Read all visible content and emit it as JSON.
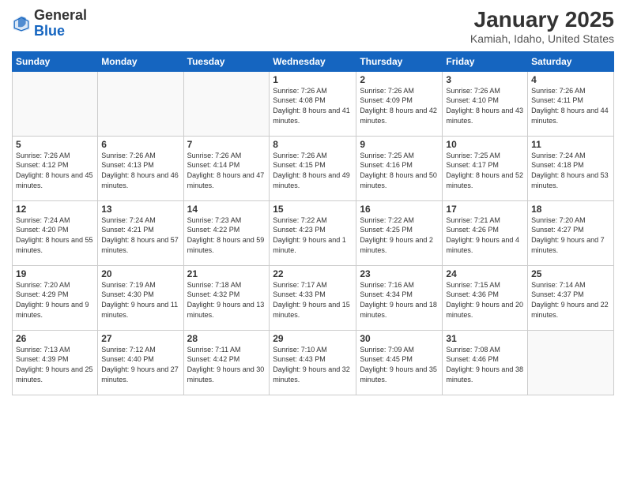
{
  "logo": {
    "general": "General",
    "blue": "Blue"
  },
  "title": "January 2025",
  "subtitle": "Kamiah, Idaho, United States",
  "days_of_week": [
    "Sunday",
    "Monday",
    "Tuesday",
    "Wednesday",
    "Thursday",
    "Friday",
    "Saturday"
  ],
  "weeks": [
    [
      {
        "day": "",
        "info": ""
      },
      {
        "day": "",
        "info": ""
      },
      {
        "day": "",
        "info": ""
      },
      {
        "day": "1",
        "info": "Sunrise: 7:26 AM\nSunset: 4:08 PM\nDaylight: 8 hours and 41 minutes."
      },
      {
        "day": "2",
        "info": "Sunrise: 7:26 AM\nSunset: 4:09 PM\nDaylight: 8 hours and 42 minutes."
      },
      {
        "day": "3",
        "info": "Sunrise: 7:26 AM\nSunset: 4:10 PM\nDaylight: 8 hours and 43 minutes."
      },
      {
        "day": "4",
        "info": "Sunrise: 7:26 AM\nSunset: 4:11 PM\nDaylight: 8 hours and 44 minutes."
      }
    ],
    [
      {
        "day": "5",
        "info": "Sunrise: 7:26 AM\nSunset: 4:12 PM\nDaylight: 8 hours and 45 minutes."
      },
      {
        "day": "6",
        "info": "Sunrise: 7:26 AM\nSunset: 4:13 PM\nDaylight: 8 hours and 46 minutes."
      },
      {
        "day": "7",
        "info": "Sunrise: 7:26 AM\nSunset: 4:14 PM\nDaylight: 8 hours and 47 minutes."
      },
      {
        "day": "8",
        "info": "Sunrise: 7:26 AM\nSunset: 4:15 PM\nDaylight: 8 hours and 49 minutes."
      },
      {
        "day": "9",
        "info": "Sunrise: 7:25 AM\nSunset: 4:16 PM\nDaylight: 8 hours and 50 minutes."
      },
      {
        "day": "10",
        "info": "Sunrise: 7:25 AM\nSunset: 4:17 PM\nDaylight: 8 hours and 52 minutes."
      },
      {
        "day": "11",
        "info": "Sunrise: 7:24 AM\nSunset: 4:18 PM\nDaylight: 8 hours and 53 minutes."
      }
    ],
    [
      {
        "day": "12",
        "info": "Sunrise: 7:24 AM\nSunset: 4:20 PM\nDaylight: 8 hours and 55 minutes."
      },
      {
        "day": "13",
        "info": "Sunrise: 7:24 AM\nSunset: 4:21 PM\nDaylight: 8 hours and 57 minutes."
      },
      {
        "day": "14",
        "info": "Sunrise: 7:23 AM\nSunset: 4:22 PM\nDaylight: 8 hours and 59 minutes."
      },
      {
        "day": "15",
        "info": "Sunrise: 7:22 AM\nSunset: 4:23 PM\nDaylight: 9 hours and 1 minute."
      },
      {
        "day": "16",
        "info": "Sunrise: 7:22 AM\nSunset: 4:25 PM\nDaylight: 9 hours and 2 minutes."
      },
      {
        "day": "17",
        "info": "Sunrise: 7:21 AM\nSunset: 4:26 PM\nDaylight: 9 hours and 4 minutes."
      },
      {
        "day": "18",
        "info": "Sunrise: 7:20 AM\nSunset: 4:27 PM\nDaylight: 9 hours and 7 minutes."
      }
    ],
    [
      {
        "day": "19",
        "info": "Sunrise: 7:20 AM\nSunset: 4:29 PM\nDaylight: 9 hours and 9 minutes."
      },
      {
        "day": "20",
        "info": "Sunrise: 7:19 AM\nSunset: 4:30 PM\nDaylight: 9 hours and 11 minutes."
      },
      {
        "day": "21",
        "info": "Sunrise: 7:18 AM\nSunset: 4:32 PM\nDaylight: 9 hours and 13 minutes."
      },
      {
        "day": "22",
        "info": "Sunrise: 7:17 AM\nSunset: 4:33 PM\nDaylight: 9 hours and 15 minutes."
      },
      {
        "day": "23",
        "info": "Sunrise: 7:16 AM\nSunset: 4:34 PM\nDaylight: 9 hours and 18 minutes."
      },
      {
        "day": "24",
        "info": "Sunrise: 7:15 AM\nSunset: 4:36 PM\nDaylight: 9 hours and 20 minutes."
      },
      {
        "day": "25",
        "info": "Sunrise: 7:14 AM\nSunset: 4:37 PM\nDaylight: 9 hours and 22 minutes."
      }
    ],
    [
      {
        "day": "26",
        "info": "Sunrise: 7:13 AM\nSunset: 4:39 PM\nDaylight: 9 hours and 25 minutes."
      },
      {
        "day": "27",
        "info": "Sunrise: 7:12 AM\nSunset: 4:40 PM\nDaylight: 9 hours and 27 minutes."
      },
      {
        "day": "28",
        "info": "Sunrise: 7:11 AM\nSunset: 4:42 PM\nDaylight: 9 hours and 30 minutes."
      },
      {
        "day": "29",
        "info": "Sunrise: 7:10 AM\nSunset: 4:43 PM\nDaylight: 9 hours and 32 minutes."
      },
      {
        "day": "30",
        "info": "Sunrise: 7:09 AM\nSunset: 4:45 PM\nDaylight: 9 hours and 35 minutes."
      },
      {
        "day": "31",
        "info": "Sunrise: 7:08 AM\nSunset: 4:46 PM\nDaylight: 9 hours and 38 minutes."
      },
      {
        "day": "",
        "info": ""
      }
    ]
  ]
}
